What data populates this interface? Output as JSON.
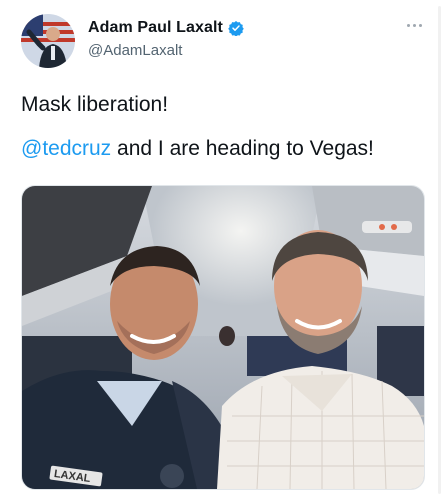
{
  "author": {
    "display_name": "Adam Paul Laxalt",
    "handle": "@AdamLaxalt",
    "verified_icon": "verified-badge-icon",
    "avatar_icon": "profile-avatar"
  },
  "tweet": {
    "line1": "Mask liberation!",
    "mention": "@tedcruz",
    "line2_rest": " and I are heading to Vegas!"
  },
  "media": {
    "alt": "Selfie of two men seated on an airplane",
    "jacket_text": "LAXAL"
  },
  "menu": {
    "icon": "more-options-icon"
  },
  "colors": {
    "text": "#0f1419",
    "secondary": "#536471",
    "link": "#1d9bf0",
    "verified": "#1d9bf0"
  }
}
